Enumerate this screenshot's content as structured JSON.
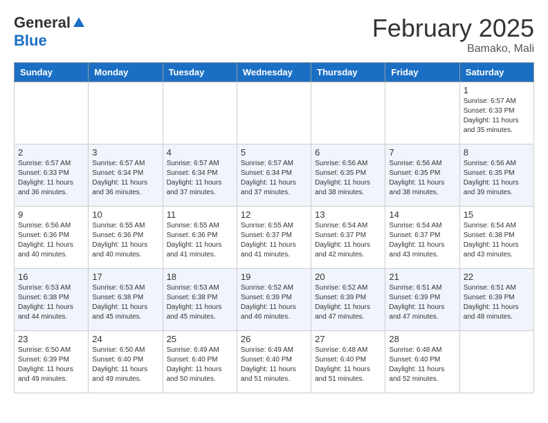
{
  "header": {
    "logo_general": "General",
    "logo_blue": "Blue",
    "title": "February 2025",
    "location": "Bamako, Mali"
  },
  "weekdays": [
    "Sunday",
    "Monday",
    "Tuesday",
    "Wednesday",
    "Thursday",
    "Friday",
    "Saturday"
  ],
  "weeks": [
    [
      {
        "day": "",
        "info": ""
      },
      {
        "day": "",
        "info": ""
      },
      {
        "day": "",
        "info": ""
      },
      {
        "day": "",
        "info": ""
      },
      {
        "day": "",
        "info": ""
      },
      {
        "day": "",
        "info": ""
      },
      {
        "day": "1",
        "info": "Sunrise: 6:57 AM\nSunset: 6:33 PM\nDaylight: 11 hours\nand 35 minutes."
      }
    ],
    [
      {
        "day": "2",
        "info": "Sunrise: 6:57 AM\nSunset: 6:33 PM\nDaylight: 11 hours\nand 36 minutes."
      },
      {
        "day": "3",
        "info": "Sunrise: 6:57 AM\nSunset: 6:34 PM\nDaylight: 11 hours\nand 36 minutes."
      },
      {
        "day": "4",
        "info": "Sunrise: 6:57 AM\nSunset: 6:34 PM\nDaylight: 11 hours\nand 37 minutes."
      },
      {
        "day": "5",
        "info": "Sunrise: 6:57 AM\nSunset: 6:34 PM\nDaylight: 11 hours\nand 37 minutes."
      },
      {
        "day": "6",
        "info": "Sunrise: 6:56 AM\nSunset: 6:35 PM\nDaylight: 11 hours\nand 38 minutes."
      },
      {
        "day": "7",
        "info": "Sunrise: 6:56 AM\nSunset: 6:35 PM\nDaylight: 11 hours\nand 38 minutes."
      },
      {
        "day": "8",
        "info": "Sunrise: 6:56 AM\nSunset: 6:35 PM\nDaylight: 11 hours\nand 39 minutes."
      }
    ],
    [
      {
        "day": "9",
        "info": "Sunrise: 6:56 AM\nSunset: 6:36 PM\nDaylight: 11 hours\nand 40 minutes."
      },
      {
        "day": "10",
        "info": "Sunrise: 6:55 AM\nSunset: 6:36 PM\nDaylight: 11 hours\nand 40 minutes."
      },
      {
        "day": "11",
        "info": "Sunrise: 6:55 AM\nSunset: 6:36 PM\nDaylight: 11 hours\nand 41 minutes."
      },
      {
        "day": "12",
        "info": "Sunrise: 6:55 AM\nSunset: 6:37 PM\nDaylight: 11 hours\nand 41 minutes."
      },
      {
        "day": "13",
        "info": "Sunrise: 6:54 AM\nSunset: 6:37 PM\nDaylight: 11 hours\nand 42 minutes."
      },
      {
        "day": "14",
        "info": "Sunrise: 6:54 AM\nSunset: 6:37 PM\nDaylight: 11 hours\nand 43 minutes."
      },
      {
        "day": "15",
        "info": "Sunrise: 6:54 AM\nSunset: 6:38 PM\nDaylight: 11 hours\nand 43 minutes."
      }
    ],
    [
      {
        "day": "16",
        "info": "Sunrise: 6:53 AM\nSunset: 6:38 PM\nDaylight: 11 hours\nand 44 minutes."
      },
      {
        "day": "17",
        "info": "Sunrise: 6:53 AM\nSunset: 6:38 PM\nDaylight: 11 hours\nand 45 minutes."
      },
      {
        "day": "18",
        "info": "Sunrise: 6:53 AM\nSunset: 6:38 PM\nDaylight: 11 hours\nand 45 minutes."
      },
      {
        "day": "19",
        "info": "Sunrise: 6:52 AM\nSunset: 6:39 PM\nDaylight: 11 hours\nand 46 minutes."
      },
      {
        "day": "20",
        "info": "Sunrise: 6:52 AM\nSunset: 6:39 PM\nDaylight: 11 hours\nand 47 minutes."
      },
      {
        "day": "21",
        "info": "Sunrise: 6:51 AM\nSunset: 6:39 PM\nDaylight: 11 hours\nand 47 minutes."
      },
      {
        "day": "22",
        "info": "Sunrise: 6:51 AM\nSunset: 6:39 PM\nDaylight: 11 hours\nand 48 minutes."
      }
    ],
    [
      {
        "day": "23",
        "info": "Sunrise: 6:50 AM\nSunset: 6:39 PM\nDaylight: 11 hours\nand 49 minutes."
      },
      {
        "day": "24",
        "info": "Sunrise: 6:50 AM\nSunset: 6:40 PM\nDaylight: 11 hours\nand 49 minutes."
      },
      {
        "day": "25",
        "info": "Sunrise: 6:49 AM\nSunset: 6:40 PM\nDaylight: 11 hours\nand 50 minutes."
      },
      {
        "day": "26",
        "info": "Sunrise: 6:49 AM\nSunset: 6:40 PM\nDaylight: 11 hours\nand 51 minutes."
      },
      {
        "day": "27",
        "info": "Sunrise: 6:48 AM\nSunset: 6:40 PM\nDaylight: 11 hours\nand 51 minutes."
      },
      {
        "day": "28",
        "info": "Sunrise: 6:48 AM\nSunset: 6:40 PM\nDaylight: 11 hours\nand 52 minutes."
      },
      {
        "day": "",
        "info": ""
      }
    ]
  ]
}
